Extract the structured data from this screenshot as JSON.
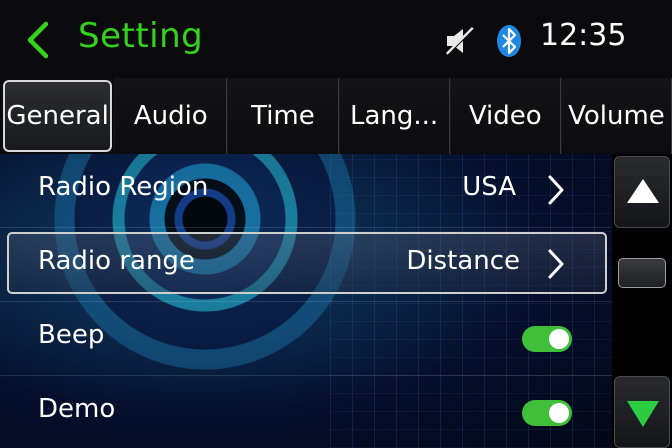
{
  "header": {
    "title": "Setting",
    "time": "12:35",
    "icons": {
      "back": "chevron-left-icon",
      "mute": "speaker-muted-icon",
      "bluetooth": "bluetooth-icon"
    },
    "colors": {
      "title": "#34d11e",
      "bluetooth": "#1e88e5"
    }
  },
  "tabs": [
    {
      "label": "General",
      "active": true
    },
    {
      "label": "Audio",
      "active": false
    },
    {
      "label": "Time",
      "active": false
    },
    {
      "label": "Lang...",
      "active": false
    },
    {
      "label": "Video",
      "active": false
    },
    {
      "label": "Volume",
      "active": false
    }
  ],
  "settings": {
    "radio_region": {
      "label": "Radio Region",
      "value": "USA"
    },
    "radio_range": {
      "label": "Radio range",
      "value": "Distance",
      "selected": true
    },
    "beep": {
      "label": "Beep",
      "enabled": true
    },
    "demo": {
      "label": "Demo",
      "enabled": true
    }
  },
  "colors": {
    "toggle_on": "#3fbf3a",
    "down_arrow": "#2ecc40"
  }
}
